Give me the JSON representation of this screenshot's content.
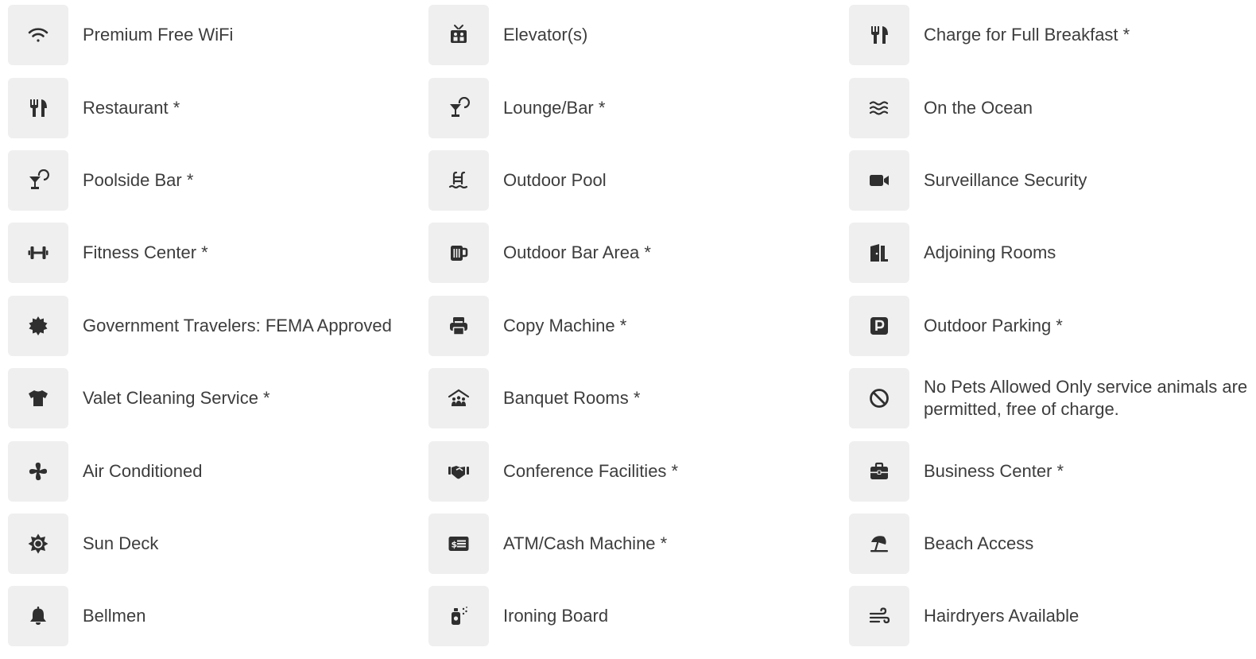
{
  "icon_color": "#2f2f2f",
  "tile_background": "#efefef",
  "amenities": [
    {
      "label": "Premium Free WiFi",
      "icon": "wifi-icon"
    },
    {
      "label": "Elevator(s)",
      "icon": "elevator-icon"
    },
    {
      "label": "Charge for Full Breakfast *",
      "icon": "utensils-icon"
    },
    {
      "label": "Restaurant *",
      "icon": "utensils-icon"
    },
    {
      "label": "Lounge/Bar *",
      "icon": "cocktail-icon"
    },
    {
      "label": "On the Ocean",
      "icon": "water-waves-icon"
    },
    {
      "label": "Poolside Bar *",
      "icon": "cocktail-icon"
    },
    {
      "label": "Outdoor Pool",
      "icon": "swimming-pool-icon"
    },
    {
      "label": "Surveillance Security",
      "icon": "video-camera-icon"
    },
    {
      "label": "Fitness Center *",
      "icon": "dumbbell-icon"
    },
    {
      "label": "Outdoor Bar Area *",
      "icon": "beer-mug-icon"
    },
    {
      "label": "Adjoining Rooms",
      "icon": "door-open-icon"
    },
    {
      "label": "Government Travelers: FEMA Approved",
      "icon": "certificate-icon"
    },
    {
      "label": "Copy Machine *",
      "icon": "printer-icon"
    },
    {
      "label": "Outdoor Parking *",
      "icon": "parking-icon"
    },
    {
      "label": "Valet Cleaning Service *",
      "icon": "shirt-icon"
    },
    {
      "label": "Banquet Rooms *",
      "icon": "people-roof-icon"
    },
    {
      "label": "No Pets Allowed Only service animals are permitted, free of charge.",
      "icon": "ban-icon"
    },
    {
      "label": "Air Conditioned",
      "icon": "fan-icon"
    },
    {
      "label": "Conference Facilities *",
      "icon": "handshake-icon"
    },
    {
      "label": "Business Center *",
      "icon": "briefcase-icon"
    },
    {
      "label": "Sun Deck",
      "icon": "sun-icon"
    },
    {
      "label": "ATM/Cash Machine *",
      "icon": "money-check-icon"
    },
    {
      "label": "Beach Access",
      "icon": "umbrella-beach-icon"
    },
    {
      "label": "Bellmen",
      "icon": "bell-icon"
    },
    {
      "label": "Ironing Board",
      "icon": "spray-bottle-icon"
    },
    {
      "label": "Hairdryers Available",
      "icon": "wind-icon"
    }
  ]
}
